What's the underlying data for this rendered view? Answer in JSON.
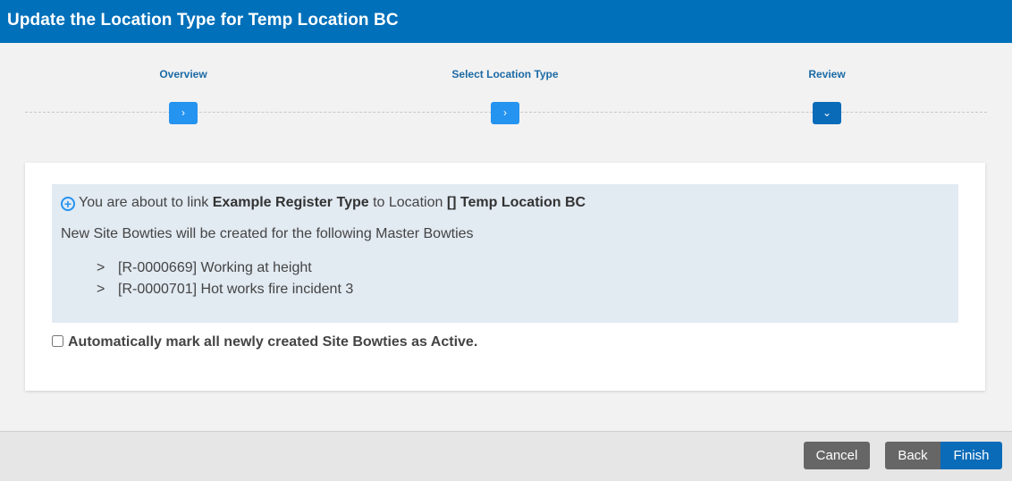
{
  "window": {
    "title": "Update the Location Type for Temp Location BC"
  },
  "wizard": {
    "steps": [
      {
        "label": "Overview",
        "icon": "chevron-right-icon",
        "glyph": "›"
      },
      {
        "label": "Select Location Type",
        "icon": "chevron-right-icon",
        "glyph": "›"
      },
      {
        "label": "Review",
        "icon": "chevron-down-icon",
        "glyph": "⌄"
      }
    ]
  },
  "info": {
    "prefix": "You are about to link ",
    "register_type": "Example Register Type",
    "middle": " to Location ",
    "location": "[] Temp Location BC",
    "subtitle": "New Site Bowties will be created for the following Master Bowties",
    "bowties": [
      {
        "arrow": ">",
        "text": "[R-0000669] Working at height"
      },
      {
        "arrow": ">",
        "text": "[R-0000701] Hot works fire incident 3"
      }
    ]
  },
  "options": {
    "auto_active_label": "Automatically mark all newly created Site Bowties as Active.",
    "auto_active_checked": false
  },
  "footer": {
    "cancel_label": "Cancel",
    "back_label": "Back",
    "finish_label": "Finish"
  },
  "colors": {
    "header": "#0070ba",
    "step_button": "#2593f0",
    "primary_button": "#0a6bb8",
    "secondary_button": "#666666"
  }
}
